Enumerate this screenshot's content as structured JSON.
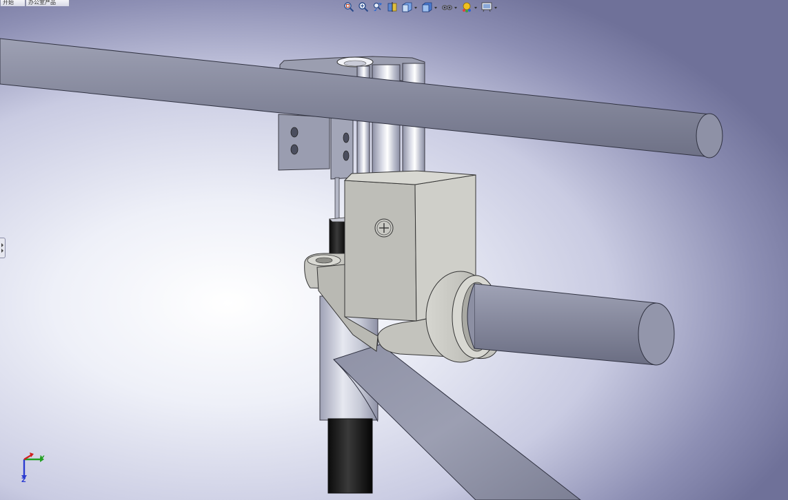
{
  "window": {
    "tabs": [
      {
        "label": "开始"
      },
      {
        "label": "办公室产品"
      }
    ]
  },
  "heads_up_toolbar": {
    "buttons": [
      {
        "icon": "zoom-to-fit-icon",
        "has_dropdown": false
      },
      {
        "icon": "zoom-to-area-icon",
        "has_dropdown": false
      },
      {
        "icon": "previous-view-icon",
        "has_dropdown": false
      },
      {
        "icon": "section-view-icon",
        "has_dropdown": false
      },
      {
        "icon": "view-orientation-icon",
        "has_dropdown": true
      },
      {
        "icon": "display-style-icon",
        "has_dropdown": true
      },
      {
        "icon": "hide-show-items-icon",
        "has_dropdown": true
      },
      {
        "icon": "edit-appearance-icon",
        "has_dropdown": true
      },
      {
        "icon": "apply-scene-icon",
        "has_dropdown": true
      }
    ]
  },
  "graphics_area": {
    "background_colors": [
      "#ffffff",
      "#c9cbe2",
      "#6f7199"
    ],
    "model_colors": {
      "tube": "#868a9e",
      "clamp_block": "#c2c2bc",
      "black_rod": "#1a1a1a",
      "lower_tube": "#d4d6e2"
    }
  },
  "triad": {
    "x_label": "X",
    "y_label": "Y",
    "z_label": "Z"
  }
}
